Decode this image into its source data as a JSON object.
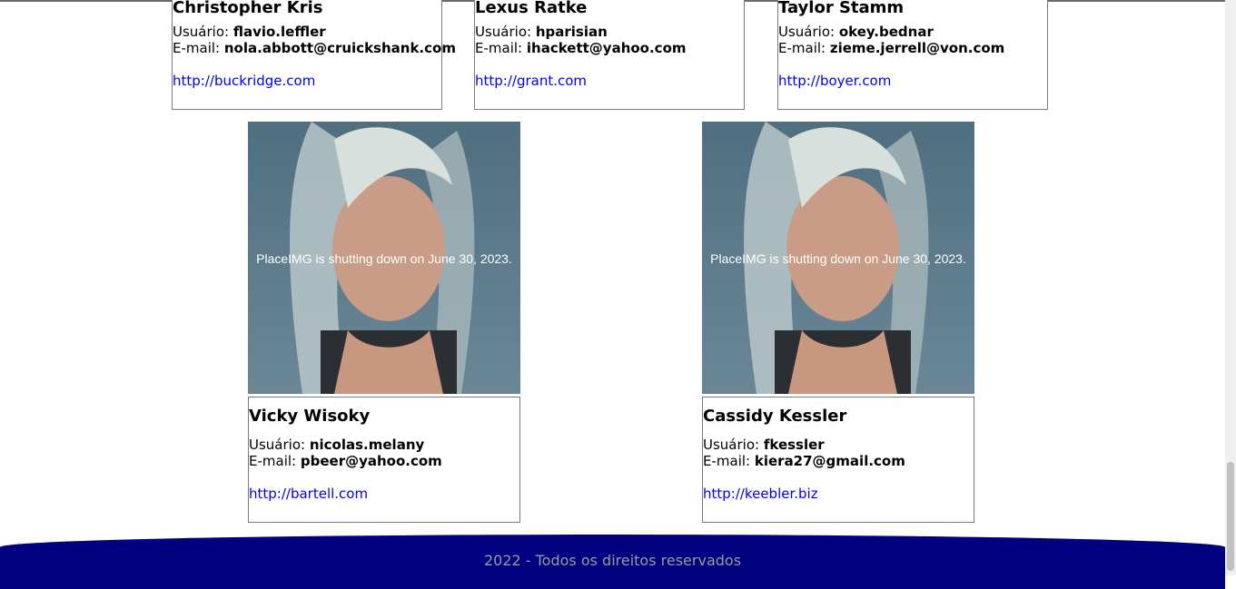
{
  "users_top": [
    {
      "name": "Christopher Kris",
      "username_label": "Usuário:",
      "username": "flavio.leffler",
      "email_label": "E-mail:",
      "email": "nola.abbott@cruickshank.com",
      "website": "http://buckridge.com"
    },
    {
      "name": "Lexus Ratke",
      "username_label": "Usuário:",
      "username": "hparisian",
      "email_label": "E-mail:",
      "email": "ihackett@yahoo.com",
      "website": "http://grant.com"
    },
    {
      "name": "Taylor Stamm",
      "username_label": "Usuário:",
      "username": "okey.bednar",
      "email_label": "E-mail:",
      "email": "zieme.jerrell@von.com",
      "website": "http://boyer.com"
    }
  ],
  "users_bottom": [
    {
      "name": "Vicky Wisoky",
      "username_label": "Usuário:",
      "username": "nicolas.melany",
      "email_label": "E-mail:",
      "email": "pbeer@yahoo.com",
      "website": "http://bartell.com",
      "photo_caption": "PlaceIMG is shutting down on June 30, 2023."
    },
    {
      "name": "Cassidy Kessler",
      "username_label": "Usuário:",
      "username": "fkessler",
      "email_label": "E-mail:",
      "email": "kiera27@gmail.com",
      "website": "http://keebler.biz",
      "photo_caption": "PlaceIMG is shutting down on June 30, 2023."
    }
  ],
  "footer": {
    "text": "2022 - Todos os direitos reservados"
  },
  "colors": {
    "footer_bg": "#000080",
    "link": "#0000ee",
    "footer_text": "#9a9a9a"
  }
}
